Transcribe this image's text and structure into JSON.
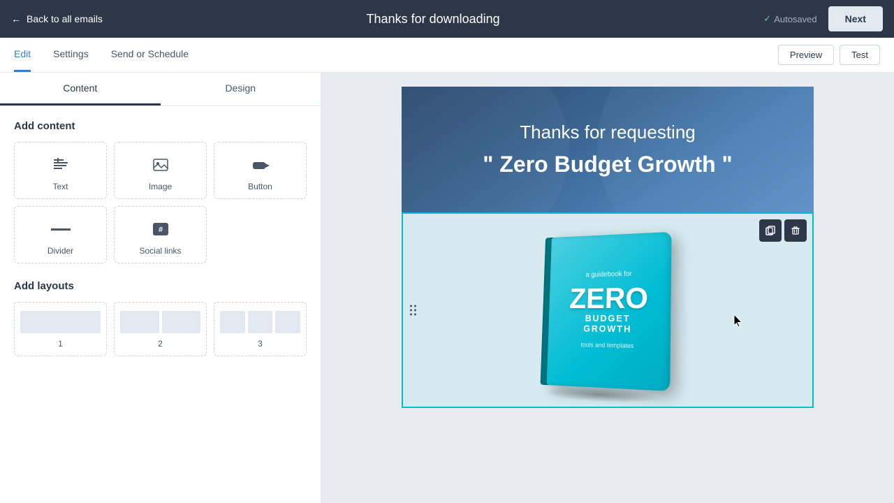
{
  "topbar": {
    "back_label": "Back to all emails",
    "title": "Thanks for downloading",
    "autosaved_label": "Autosaved",
    "next_label": "Next"
  },
  "secondary_nav": {
    "tabs": [
      {
        "id": "edit",
        "label": "Edit",
        "active": true
      },
      {
        "id": "settings",
        "label": "Settings",
        "active": false
      },
      {
        "id": "send_schedule",
        "label": "Send or Schedule",
        "active": false
      }
    ],
    "preview_label": "Preview",
    "test_label": "Test"
  },
  "left_panel": {
    "tabs": [
      {
        "id": "content",
        "label": "Content",
        "active": true
      },
      {
        "id": "design",
        "label": "Design",
        "active": false
      }
    ],
    "add_content_title": "Add content",
    "content_items": [
      {
        "id": "text",
        "label": "Text"
      },
      {
        "id": "image",
        "label": "Image"
      },
      {
        "id": "button",
        "label": "Button"
      },
      {
        "id": "divider",
        "label": "Divider"
      },
      {
        "id": "social_links",
        "label": "Social links"
      }
    ],
    "add_layouts_title": "Add layouts",
    "layout_items": [
      {
        "id": "1col",
        "label": "1",
        "cols": 1
      },
      {
        "id": "2col",
        "label": "2",
        "cols": 2
      },
      {
        "id": "3col",
        "label": "3",
        "cols": 3
      }
    ]
  },
  "email_content": {
    "header_line1": "Thanks for requesting",
    "header_line2": "\" Zero Budget Growth \"",
    "book": {
      "guidebook_for": "a guidebook for",
      "zero": "ZERO",
      "budget_growth": "BUDGET GROWTH",
      "tools_templates": "tools and templates"
    }
  },
  "block_actions": {
    "copy_title": "Copy",
    "delete_title": "Delete"
  }
}
